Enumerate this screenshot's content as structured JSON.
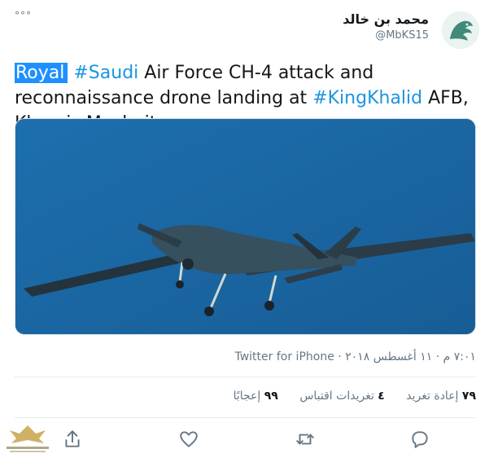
{
  "tweet": {
    "more_label": "°°°",
    "author": {
      "name": "محمد بن خالد",
      "handle": "@MbKS15"
    },
    "text": {
      "highlight": "Royal",
      "tag1": "#Saudi",
      "part1": " Air Force CH-4 attack and reconnaissance drone landing at ",
      "tag2": "#KingKhalid",
      "part2": " AFB, Khamis Mushait"
    },
    "source": "Twitter for iPhone",
    "timestamp": "٧:٠١ م · ١١ أغسطس ٢٠١٨",
    "separator": " · ",
    "stats": {
      "retweets_count": "٧٩",
      "retweets_label": "إعادة تغريد",
      "quotes_count": "٤",
      "quotes_label": "تغريدات اقتباس",
      "likes_count": "٩٩",
      "likes_label": "إعجابًا"
    },
    "actions": [
      "reply-icon",
      "retweet-icon",
      "like-icon",
      "share-icon"
    ],
    "colors": {
      "link": "#1b95e0",
      "highlight": "#1e90ff",
      "secondary": "#657786",
      "sky": "#1c6aa8"
    }
  }
}
